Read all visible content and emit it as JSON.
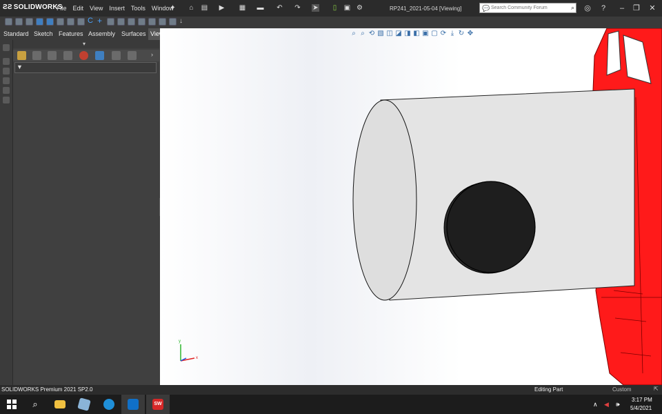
{
  "app": {
    "brand": "SOLIDWORKS",
    "document_title": "RP241_2021-05-04 [Viewing]"
  },
  "menu": [
    "File",
    "Edit",
    "View",
    "Insert",
    "Tools",
    "Window"
  ],
  "search": {
    "placeholder": "Search Community Forum"
  },
  "tabs": [
    {
      "label": "Standard",
      "active": false
    },
    {
      "label": "Sketch",
      "active": false
    },
    {
      "label": "Features",
      "active": false
    },
    {
      "label": "Assembly",
      "active": false
    },
    {
      "label": "Surfaces",
      "active": false
    },
    {
      "label": "View",
      "active": true
    }
  ],
  "viewport": {
    "triad": {
      "x_label": "x",
      "y_label": "y"
    },
    "model_colors": {
      "cylinder": "#e4e4e4",
      "cap": "#1e1e1e",
      "body": "#ff1a1a"
    }
  },
  "status": {
    "product": "SOLIDWORKS Premium 2021 SP2.0",
    "mode": "Editing Part",
    "units": "Custom"
  },
  "taskbar": {
    "time": "3:17 PM",
    "date": "5/4/2021",
    "sw_app_label": "SW"
  },
  "icons": {
    "windows": "windows-start-icon",
    "search": "search-icon",
    "explorer": "folder-icon",
    "edge": "edge-icon",
    "outlook": "outlook-icon"
  }
}
